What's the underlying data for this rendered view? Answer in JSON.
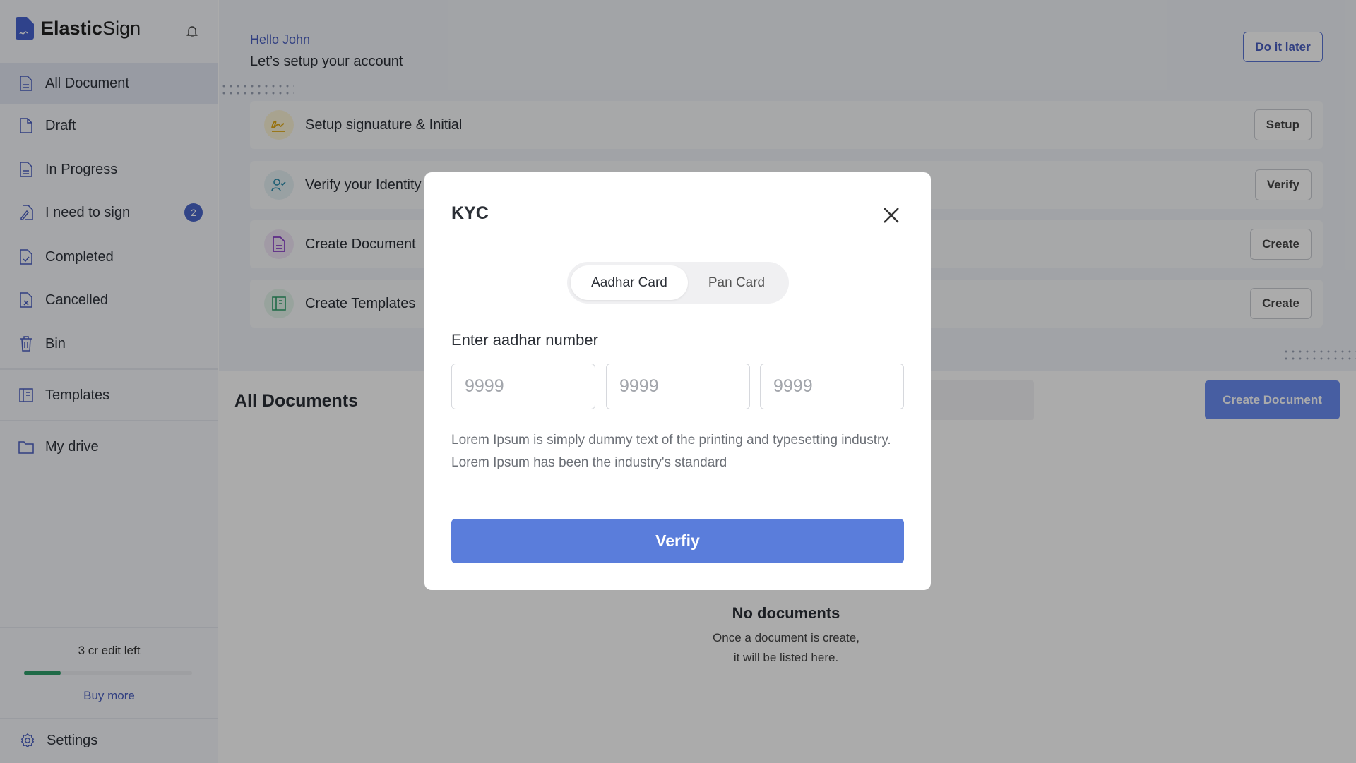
{
  "app": {
    "brand_bold": "Elastic",
    "brand_light": "Sign"
  },
  "sidebar": {
    "items": [
      {
        "label": "All Document",
        "icon": "document-icon",
        "selected": true
      },
      {
        "label": "Draft",
        "icon": "file-icon"
      },
      {
        "label": "In Progress",
        "icon": "document-icon"
      },
      {
        "label": "I need to sign",
        "icon": "sign-pen-icon",
        "badge": "2"
      },
      {
        "label": "Completed",
        "icon": "document-check-icon"
      },
      {
        "label": "Cancelled",
        "icon": "document-x-icon"
      },
      {
        "label": "Bin",
        "icon": "trash-icon"
      }
    ],
    "templates": "Templates",
    "my_drive": "My drive",
    "credits": {
      "text": "3 cr edit left",
      "progress_percent": 22,
      "buy_more": "Buy more"
    },
    "settings": "Settings"
  },
  "header": {
    "greeting": "Hello John",
    "subtitle": "Let’s setup your account",
    "do_it_later": "Do it later",
    "steps": [
      {
        "label": "Setup signuature & Initial",
        "button": "Setup",
        "icon": "signature-icon"
      },
      {
        "label": "Verify your Identity",
        "button": "Verify",
        "icon": "user-check-icon"
      },
      {
        "label": "Create Document",
        "button": "Create",
        "icon": "document-icon"
      },
      {
        "label": "Create Templates",
        "button": "Create",
        "icon": "template-icon"
      }
    ]
  },
  "documents": {
    "title": "All Documents",
    "create_button": "Create Document",
    "empty_title": "No documents",
    "empty_line1": "Once a document is create,",
    "empty_line2": "it will be listed here."
  },
  "modal": {
    "title": "KYC",
    "tabs": [
      "Aadhar Card",
      "Pan Card"
    ],
    "active_tab": "Aadhar Card",
    "field_label": "Enter aadhar number",
    "placeholders": [
      "9999",
      "9999",
      "9999"
    ],
    "description": "Lorem Ipsum is simply dummy text of the printing and typesetting industry. Lorem Ipsum has been the industry's standard",
    "submit": "Verfiy"
  },
  "colors": {
    "accent": "#5a7ddb",
    "progress": "#2f9e6b",
    "link": "#4a5fc1"
  }
}
